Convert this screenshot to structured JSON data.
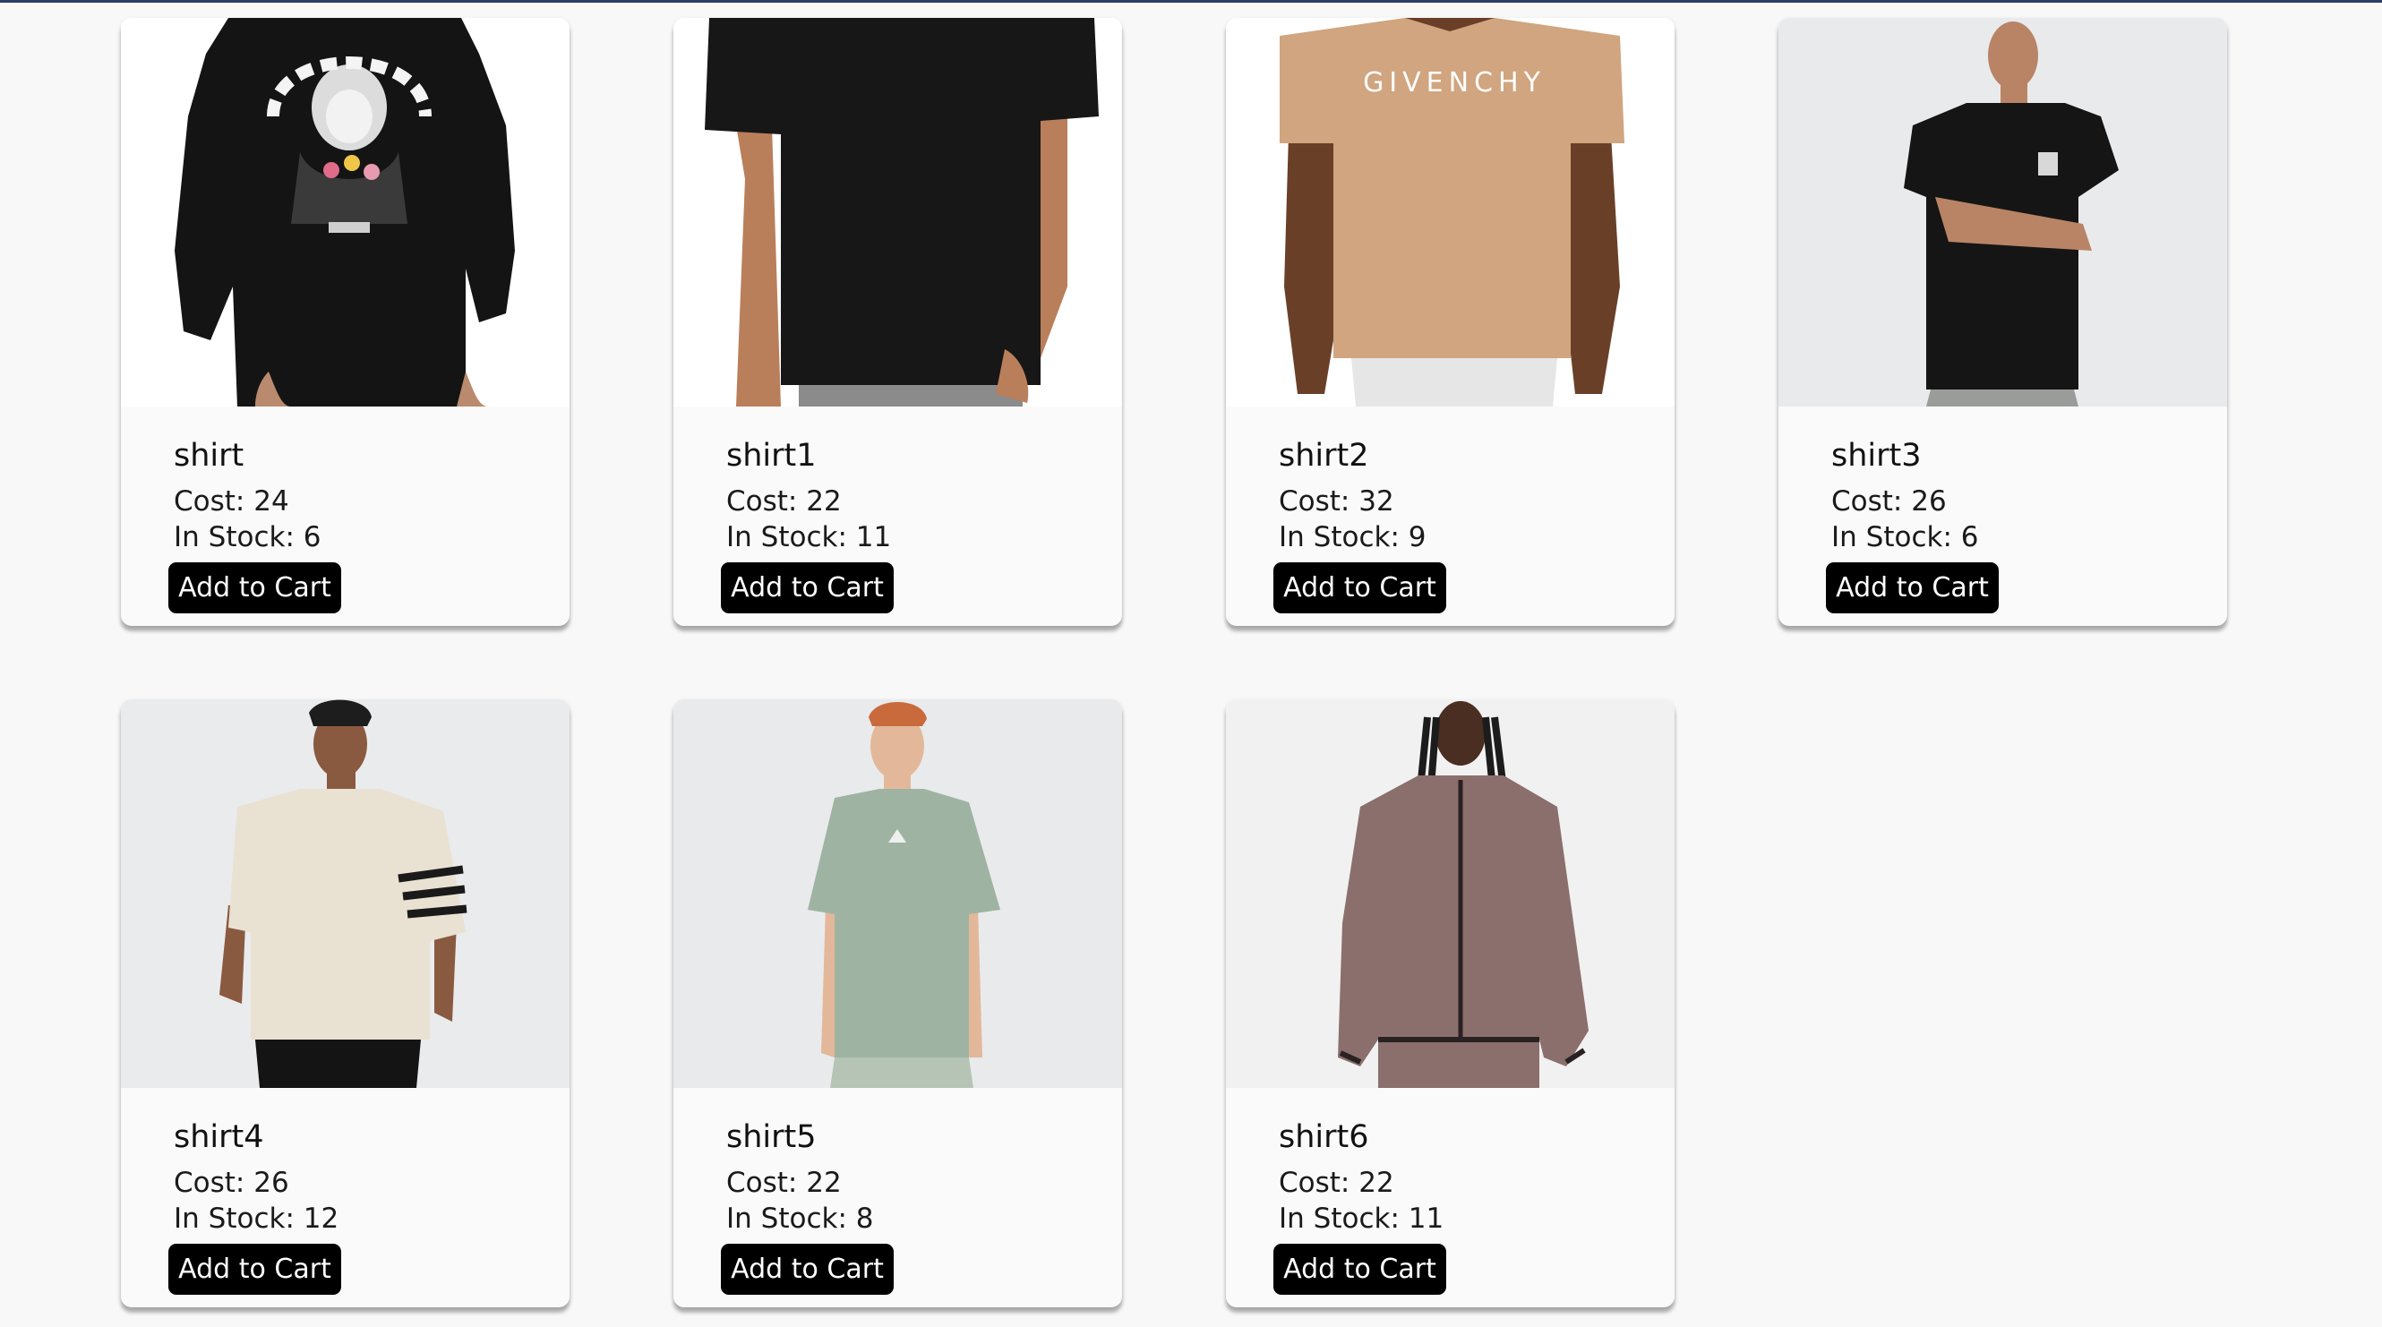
{
  "products": [
    {
      "name": "shirt",
      "cost_label": "Cost: 24",
      "stock_label": "In Stock: 6",
      "button_label": "Add to Cart",
      "image_icon": "black-longsleeve-shirt-photo",
      "colors": {
        "bg": "#ffffff",
        "garment": "#141414",
        "skin": "#b98a6e"
      }
    },
    {
      "name": "shirt1",
      "cost_label": "Cost: 22",
      "stock_label": "In Stock: 11",
      "button_label": "Add to Cart",
      "image_icon": "black-tshirt-photo",
      "colors": {
        "bg": "#ffffff",
        "garment": "#171717",
        "skin": "#b97f5a"
      }
    },
    {
      "name": "shirt2",
      "cost_label": "Cost: 32",
      "stock_label": "In Stock: 9",
      "button_label": "Add to Cart",
      "image_icon": "tan-givenchy-tshirt-photo",
      "colors": {
        "bg": "#ffffff",
        "garment": "#d0a57f",
        "skin": "#6a3f28"
      }
    },
    {
      "name": "shirt3",
      "cost_label": "Cost: 26",
      "stock_label": "In Stock: 6",
      "button_label": "Add to Cart",
      "image_icon": "black-tshirt-model-photo",
      "colors": {
        "bg": "#e9eaec",
        "garment": "#151515",
        "skin": "#b98466"
      }
    },
    {
      "name": "shirt4",
      "cost_label": "Cost: 26",
      "stock_label": "In Stock: 12",
      "button_label": "Add to Cart",
      "image_icon": "cream-tshirt-model-photo",
      "colors": {
        "bg": "#eaebed",
        "garment": "#e9e1d2",
        "skin": "#8a5a40"
      }
    },
    {
      "name": "shirt5",
      "cost_label": "Cost: 22",
      "stock_label": "In Stock: 8",
      "button_label": "Add to Cart",
      "image_icon": "sage-tshirt-model-photo",
      "colors": {
        "bg": "#e9eaec",
        "garment": "#9fb3a2",
        "skin": "#e3b89a"
      }
    },
    {
      "name": "shirt6",
      "cost_label": "Cost: 22",
      "stock_label": "In Stock: 11",
      "button_label": "Add to Cart",
      "image_icon": "mauve-zip-jacket-photo",
      "colors": {
        "bg": "#f1f1f1",
        "garment": "#8a6f6c",
        "skin": "#4a2e22"
      }
    }
  ]
}
